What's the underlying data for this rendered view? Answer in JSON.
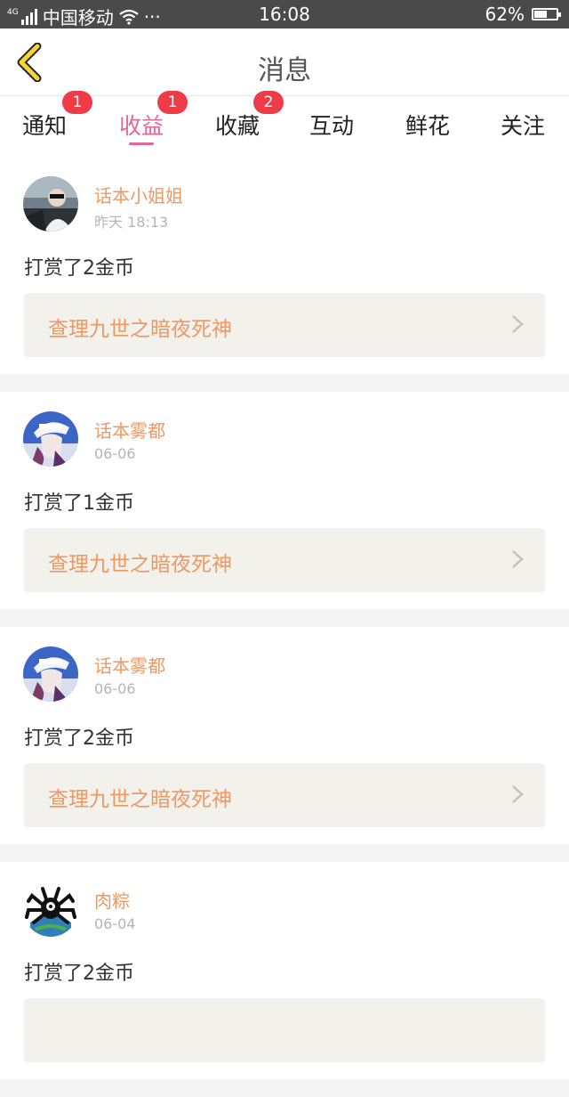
{
  "status_bar": {
    "network_tag": "4G",
    "carrier": "中国移动",
    "more": "···",
    "time": "16:08",
    "battery": "62%",
    "battery_level": 0.62
  },
  "header": {
    "title": "消息"
  },
  "tabs": [
    {
      "label": "通知",
      "badge": "1",
      "active": false
    },
    {
      "label": "收益",
      "badge": "1",
      "active": true
    },
    {
      "label": "收藏",
      "badge": "2",
      "active": false
    },
    {
      "label": "互动",
      "badge": "",
      "active": false
    },
    {
      "label": "鲜花",
      "badge": "",
      "active": false
    },
    {
      "label": "关注",
      "badge": "",
      "active": false
    }
  ],
  "messages": [
    {
      "user": "话本小姐姐",
      "time": "昨天 18:13",
      "text": "打赏了2金币",
      "work": "查理九世之暗夜死神",
      "avatar": "photo-avatar"
    },
    {
      "user": "话本雾都",
      "time": "06-06",
      "text": "打赏了1金币",
      "work": "查理九世之暗夜死神",
      "avatar": "anime-avatar"
    },
    {
      "user": "话本雾都",
      "time": "06-06",
      "text": "打赏了2金币",
      "work": "查理九世之暗夜死神",
      "avatar": "anime-avatar"
    },
    {
      "user": "肉粽",
      "time": "06-04",
      "text": "打赏了2金币",
      "work": "",
      "avatar": "spider-avatar"
    }
  ],
  "colors": {
    "accent": "#e0679d",
    "name": "#ee9862",
    "badge": "#ef3b47",
    "back_arrow": "#f5d635"
  }
}
